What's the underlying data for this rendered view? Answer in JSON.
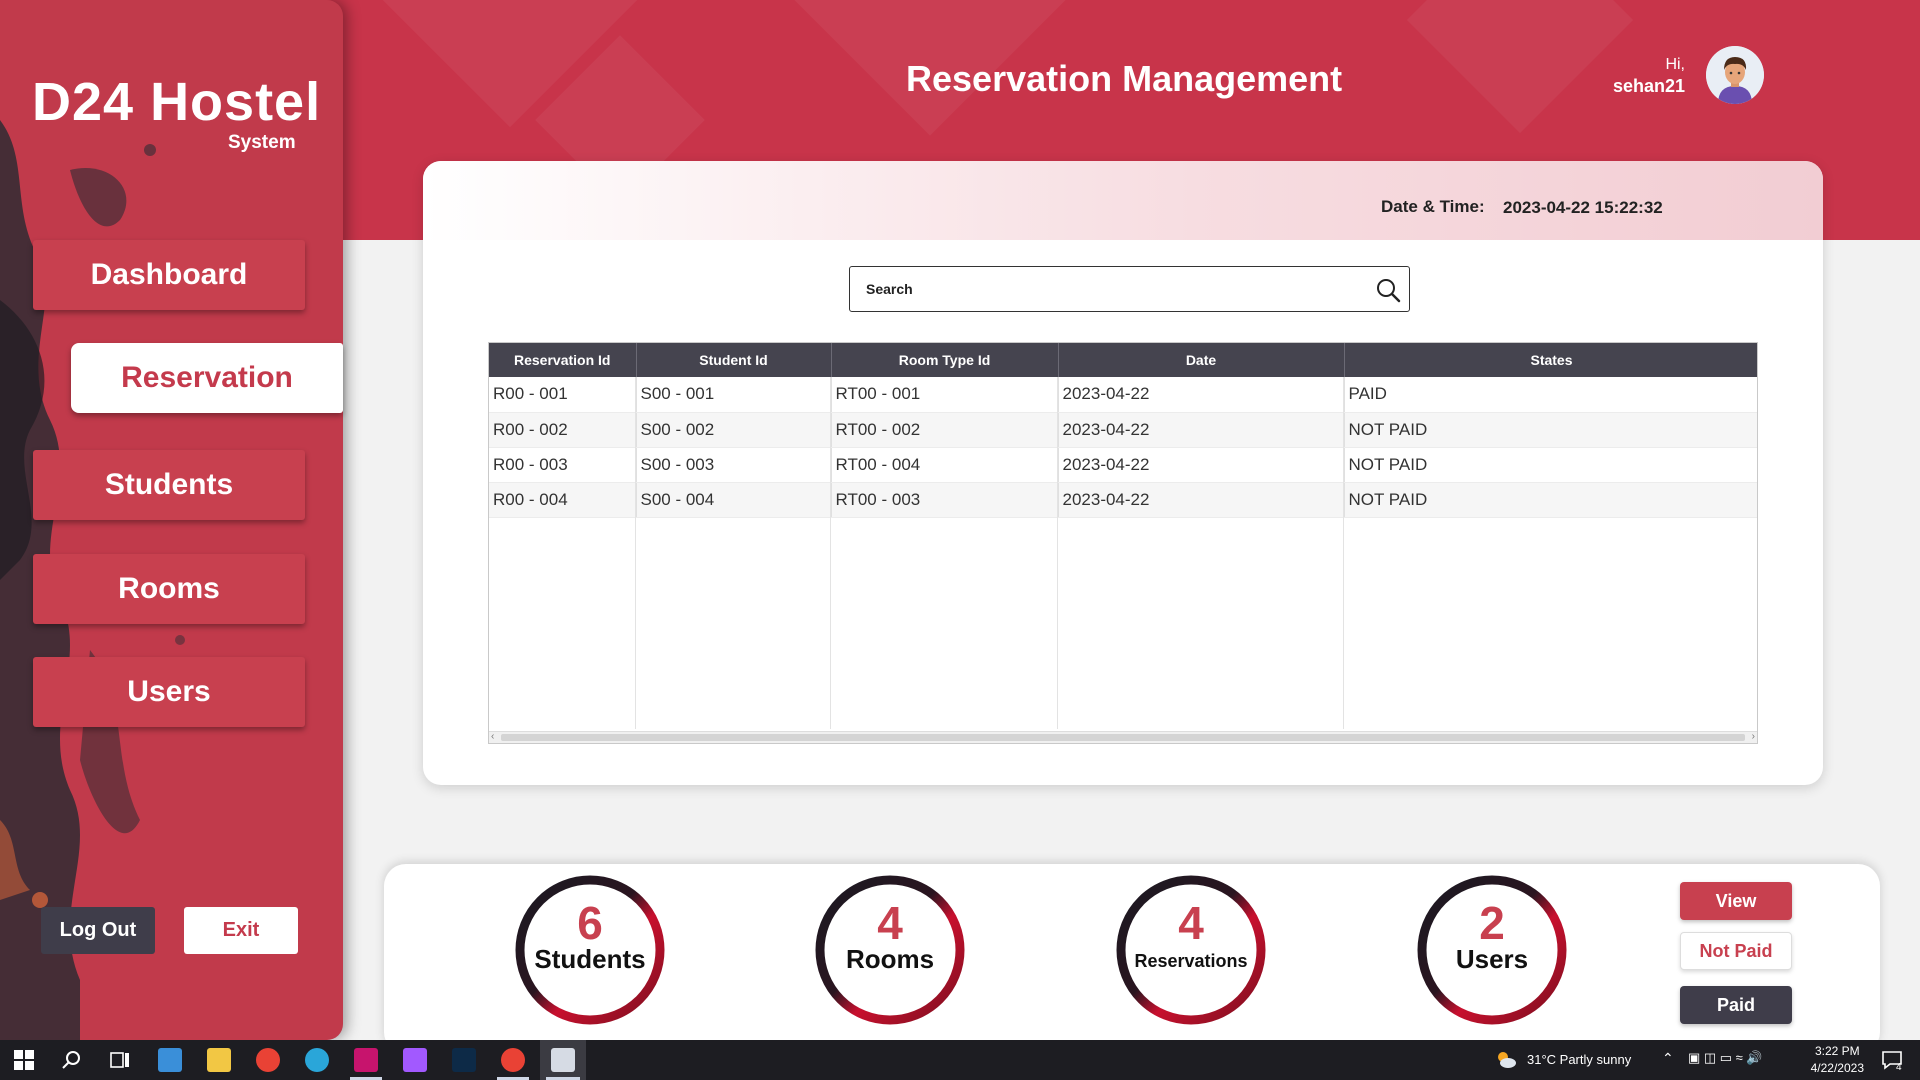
{
  "app": {
    "brand_title": "D24 Hostel",
    "brand_sub": "System",
    "page_title": "Reservation Management",
    "greeting": "Hi,",
    "username": "sehan21"
  },
  "sidebar": {
    "items": [
      {
        "label": "Dashboard",
        "active": false
      },
      {
        "label": "Reservation",
        "active": true
      },
      {
        "label": "Students",
        "active": false
      },
      {
        "label": "Rooms",
        "active": false
      },
      {
        "label": "Users",
        "active": false
      }
    ],
    "logout_label": "Log Out",
    "exit_label": "Exit"
  },
  "datetime": {
    "label": "Date & Time:",
    "value": "2023-04-22 15:22:32"
  },
  "search": {
    "placeholder": "Search",
    "icon": "search-icon"
  },
  "table": {
    "columns": [
      "Reservation Id",
      "Student Id",
      "Room Type Id",
      "Date",
      "States"
    ],
    "rows": [
      [
        "R00 - 001",
        "S00 - 001",
        "RT00 - 001",
        "2023-04-22",
        "PAID"
      ],
      [
        "R00 - 002",
        "S00 - 002",
        "RT00 - 002",
        "2023-04-22",
        "NOT PAID"
      ],
      [
        "R00 - 003",
        "S00 - 003",
        "RT00 - 004",
        "2023-04-22",
        "NOT PAID"
      ],
      [
        "R00 - 004",
        "S00 - 004",
        "RT00 - 003",
        "2023-04-22",
        "NOT PAID"
      ]
    ]
  },
  "stats": [
    {
      "count": "6",
      "label": "Students"
    },
    {
      "count": "4",
      "label": "Rooms"
    },
    {
      "count": "4",
      "label": "Reservations"
    },
    {
      "count": "2",
      "label": "Users"
    }
  ],
  "actions": {
    "view_label": "View",
    "not_paid_label": "Not Paid",
    "paid_label": "Paid"
  },
  "taskbar": {
    "weather": "31°C  Partly sunny",
    "time": "3:22 PM",
    "date": "4/22/2023",
    "notification_count": "4"
  },
  "colors": {
    "accent": "#c8404f",
    "dark": "#3f3d4a",
    "header_band": "#c8344a"
  }
}
